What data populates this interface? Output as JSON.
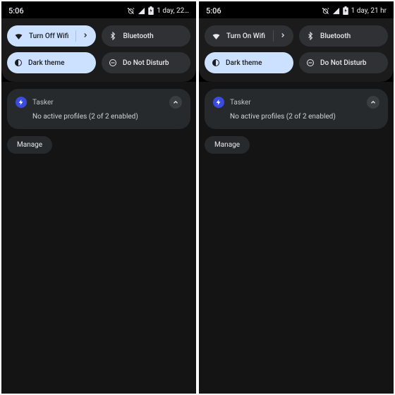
{
  "phones": [
    {
      "status": {
        "time": "5:06",
        "batt_text": "1 day, 22…"
      },
      "tiles": {
        "wifi": {
          "label": "Turn Off Wifi",
          "on": true,
          "chevron": true
        },
        "bt": {
          "label": "Bluetooth",
          "on": false,
          "chevron": false
        },
        "dark": {
          "label": "Dark theme",
          "on": true,
          "chevron": false
        },
        "dnd": {
          "label": "Do Not Disturb",
          "on": false,
          "chevron": false
        }
      },
      "notif": {
        "app": "Tasker",
        "body": "No active profiles (2 of 2 enabled)"
      },
      "manage": "Manage"
    },
    {
      "status": {
        "time": "5:06",
        "batt_text": "1 day, 21 hr"
      },
      "tiles": {
        "wifi": {
          "label": "Turn On Wifi",
          "on": false,
          "chevron": true
        },
        "bt": {
          "label": "Bluetooth",
          "on": false,
          "chevron": false
        },
        "dark": {
          "label": "Dark theme",
          "on": true,
          "chevron": false
        },
        "dnd": {
          "label": "Do Not Disturb",
          "on": false,
          "chevron": false
        }
      },
      "notif": {
        "app": "Tasker",
        "body": "No active profiles (2 of 2 enabled)"
      },
      "manage": "Manage"
    }
  ]
}
